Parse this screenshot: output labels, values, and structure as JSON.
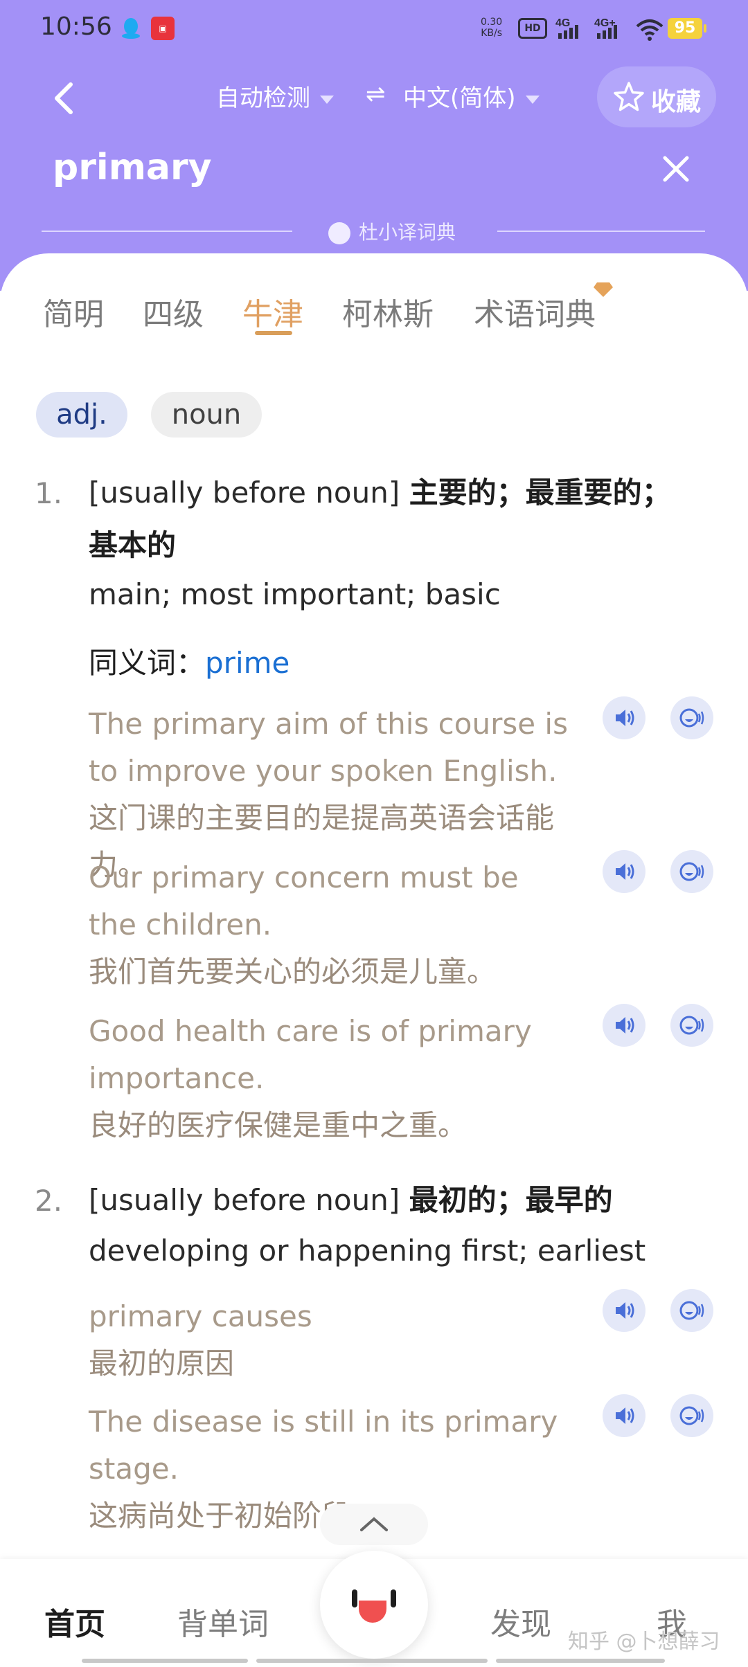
{
  "status": {
    "time": "10:56",
    "net_speed_value": "0.30",
    "net_speed_unit": "KB/s",
    "hd": "HD",
    "hd_sub": "2",
    "sig1": "4G",
    "sig2": "4G+",
    "battery": "95"
  },
  "header": {
    "source_lang": "自动检测",
    "swap_symbol": "⇌",
    "target_lang": "中文(简体)",
    "favorite_label": "收藏",
    "query": "primary",
    "dict_source": "杜小译词典"
  },
  "tabs": [
    {
      "label": "简明"
    },
    {
      "label": "四级"
    },
    {
      "label": "牛津"
    },
    {
      "label": "柯林斯"
    },
    {
      "label": "术语词典"
    }
  ],
  "parts_of_speech": [
    "adj.",
    "noun"
  ],
  "senses": [
    {
      "num": "1.",
      "grammar": "[usually before noun]",
      "zh_def": "主要的；最重要的；基本的",
      "en_def": "main; most important; basic",
      "synonym_label": "同义词：",
      "synonym": "prime",
      "examples": [
        {
          "en": "The primary aim of this course is to improve your spoken English.",
          "zh": "这门课的主要目的是提高英语会话能力。"
        },
        {
          "en": "Our primary concern must be the children.",
          "zh": "我们首先要关心的必须是儿童。"
        },
        {
          "en": "Good health care is of primary importance.",
          "zh": "良好的医疗保健是重中之重。"
        }
      ]
    },
    {
      "num": "2.",
      "grammar": "[usually before noun]",
      "zh_def": "最初的；最早的",
      "en_def": "developing or happening first; earliest",
      "examples": [
        {
          "en": "primary causes",
          "zh": "最初的原因"
        },
        {
          "en": "The disease is still in its primary stage.",
          "zh": "这病尚处于初始阶段。"
        }
      ]
    }
  ],
  "bottom_nav": {
    "home": "首页",
    "words": "背单词",
    "discover": "发现",
    "me": "我"
  },
  "watermark": "知乎 @卜想薛习",
  "colors": {
    "header_bg": "#a391f7",
    "active_tab": "#e0a062",
    "synonym_link": "#1a6fd3",
    "example_text": "#a89a8a"
  }
}
